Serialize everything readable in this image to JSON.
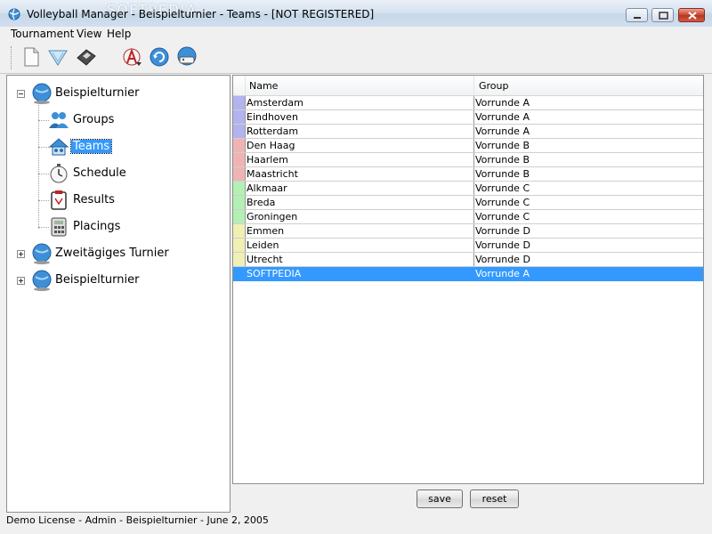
{
  "window": {
    "title": "Volleyball Manager - Beispielturnier - Teams - [NOT REGISTERED]",
    "watermark": "SOFTPEDIA"
  },
  "menu": {
    "items": [
      "Tournament",
      "View",
      "Help"
    ]
  },
  "toolbar": {
    "icons": [
      "new-document-icon",
      "open-tournament-icon",
      "save-disk-icon",
      "pdf-export-icon",
      "refresh-icon",
      "info-icon"
    ]
  },
  "tree": {
    "nodes": [
      {
        "label": "Beispielturnier",
        "expanded": true,
        "children": [
          "Groups",
          "Teams",
          "Schedule",
          "Results",
          "Placings"
        ],
        "selected_child": "Teams"
      },
      {
        "label": "Zweitägiges Turnier",
        "expanded": false
      },
      {
        "label": "Beispielturnier",
        "expanded": false
      }
    ]
  },
  "table": {
    "columns": [
      "Name",
      "Group"
    ],
    "rows": [
      {
        "name": "Amsterdam",
        "group": "Vorrunde A",
        "color": "#b3b3f0"
      },
      {
        "name": "Eindhoven",
        "group": "Vorrunde A",
        "color": "#b3b3f0"
      },
      {
        "name": "Rotterdam",
        "group": "Vorrunde A",
        "color": "#b3b3f0"
      },
      {
        "name": "Den Haag",
        "group": "Vorrunde B",
        "color": "#f0b3b3"
      },
      {
        "name": "Haarlem",
        "group": "Vorrunde B",
        "color": "#f0b3b3"
      },
      {
        "name": "Maastricht",
        "group": "Vorrunde B",
        "color": "#f0b3b3"
      },
      {
        "name": "Alkmaar",
        "group": "Vorrunde C",
        "color": "#b3f0b3"
      },
      {
        "name": "Breda",
        "group": "Vorrunde C",
        "color": "#b3f0b3"
      },
      {
        "name": "Groningen",
        "group": "Vorrunde C",
        "color": "#b3f0b3"
      },
      {
        "name": "Emmen",
        "group": "Vorrunde D",
        "color": "#f0f0b3"
      },
      {
        "name": "Leiden",
        "group": "Vorrunde D",
        "color": "#f0f0b3"
      },
      {
        "name": "Utrecht",
        "group": "Vorrunde D",
        "color": "#f0f0b3"
      },
      {
        "name": "SOFTPEDIA",
        "group": "Vorrunde A",
        "color": "#3399ff",
        "selected": true
      }
    ]
  },
  "buttons": {
    "save": "save",
    "reset": "reset"
  },
  "status": {
    "text": "Demo License - Admin - Beispielturnier - June 2, 2005"
  },
  "colors": {
    "selection": "#3399ff",
    "group_a": "#b3b3f0",
    "group_b": "#f0b3b3",
    "group_c": "#b3f0b3",
    "group_d": "#f0f0b3"
  }
}
